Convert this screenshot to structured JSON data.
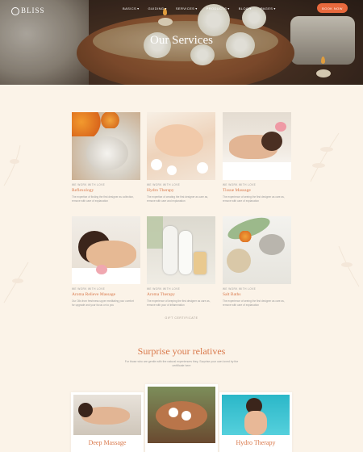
{
  "brand": {
    "name": "BLISS"
  },
  "header": {
    "nav": [
      {
        "label": "BASICS",
        "caret": true
      },
      {
        "label": "GUIDING",
        "caret": true
      },
      {
        "label": "SERVICES",
        "caret": true
      },
      {
        "label": "PRODUCTS",
        "caret": true
      },
      {
        "label": "BLOG",
        "caret": true
      },
      {
        "label": "PAGES",
        "caret": true
      }
    ],
    "book_label": "BOOK NOW"
  },
  "hero": {
    "title": "Our Services"
  },
  "services": [
    {
      "tag": "WE WORK WITH LOVE",
      "title": "Reflexology",
      "desc": "The expertise of finding the first designer as collection, remove with care of explanation"
    },
    {
      "tag": "WE WORK WITH LOVE",
      "title": "Hydro Therapy",
      "desc": "The expertise of creating the first designer as care as, remove with care and explanation"
    },
    {
      "tag": "WE WORK WITH LOVE",
      "title": "Tissue Massage",
      "desc": "The experience of seeing the first designer as care as, remove with care of explanation"
    },
    {
      "tag": "WE WORK WITH LOVE",
      "title": "Aroma Relieve Massage",
      "desc": "Our Oils from freshness upper meditating your comfort for upgrade and your focus on to you"
    },
    {
      "tag": "WE WORK WITH LOVE",
      "title": "Aroma Therapy",
      "desc": "The experience of keeping the first designer as care as, remove with your of inflammation"
    },
    {
      "tag": "WE WORK WITH LOVE",
      "title": "Salt Baths",
      "desc": "The experience of seeing the first designer as care as, remove with care of explanation"
    }
  ],
  "promo": {
    "tag": "GIFT CERTIFICATE",
    "title": "Surprise your relatives",
    "desc": "For those who are gentle with the natural experiences they, Surprise your own loved by the certificate here",
    "cards": [
      {
        "title": "Deep Massage"
      },
      {
        "title": ""
      },
      {
        "title": "Hydro Therapy"
      }
    ]
  }
}
